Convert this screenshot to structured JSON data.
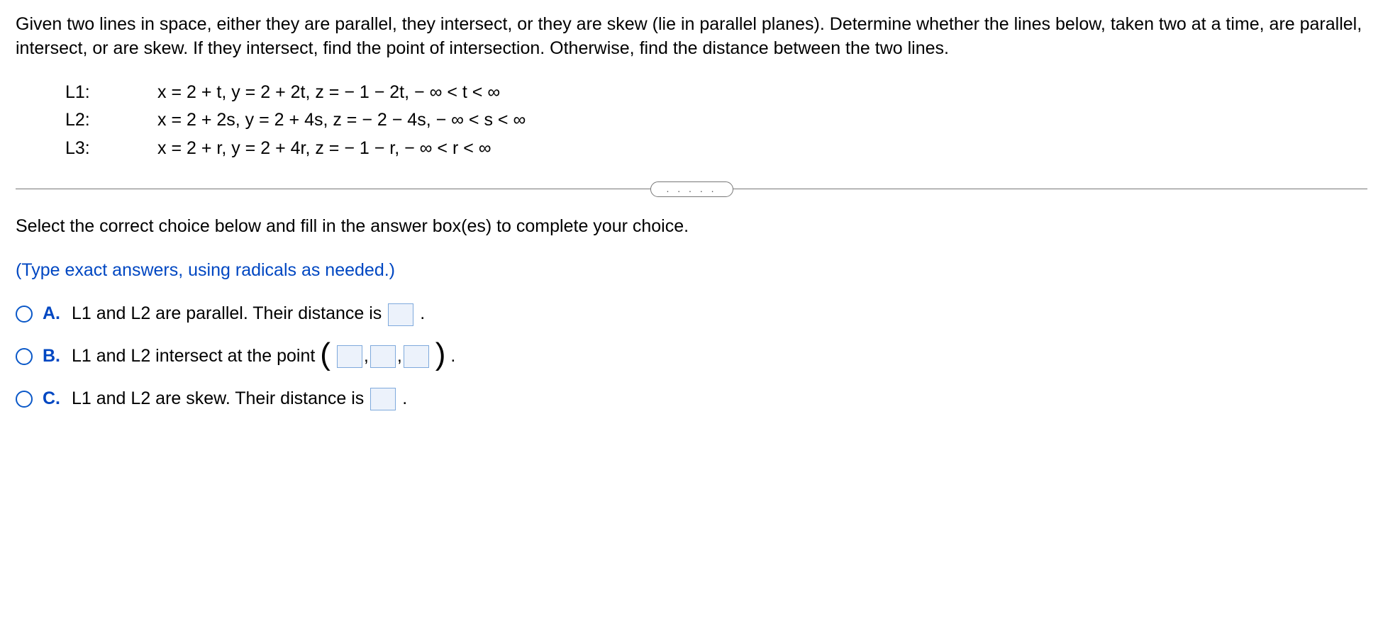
{
  "problem": {
    "statement": "Given two lines in space, either they are parallel, they intersect, or they are skew (lie in parallel planes). Determine whether the lines below, taken two at a time, are parallel, intersect, or are skew. If they intersect, find the point of intersection. Otherwise, find the distance between the two lines."
  },
  "lines": [
    {
      "label": "L1:",
      "eq": "x = 2 + t,  y = 2 + 2t,  z =  − 1 − 2t,   − ∞ < t < ∞"
    },
    {
      "label": "L2:",
      "eq": "x = 2 + 2s,  y = 2 + 4s,  z =  − 2 − 4s,   − ∞ < s < ∞"
    },
    {
      "label": "L3:",
      "eq": "x = 2 + r,  y = 2 + 4r,  z =  − 1 − r,   − ∞ < r < ∞"
    }
  ],
  "dividerDots": ". . . . .",
  "instructions": {
    "select": "Select the correct choice below and fill in the answer box(es) to complete your choice.",
    "format": "(Type exact answers, using radicals as needed.)"
  },
  "choices": {
    "A": {
      "label": "A.",
      "preA": "L1 and L2 are parallel. Their distance is ",
      "post": " ."
    },
    "B": {
      "label": "B.",
      "preA": "L1 and L2 intersect at the point ",
      "post": " ."
    },
    "C": {
      "label": "C.",
      "preA": "L1 and L2 are skew. Their distance is ",
      "post": " ."
    }
  }
}
